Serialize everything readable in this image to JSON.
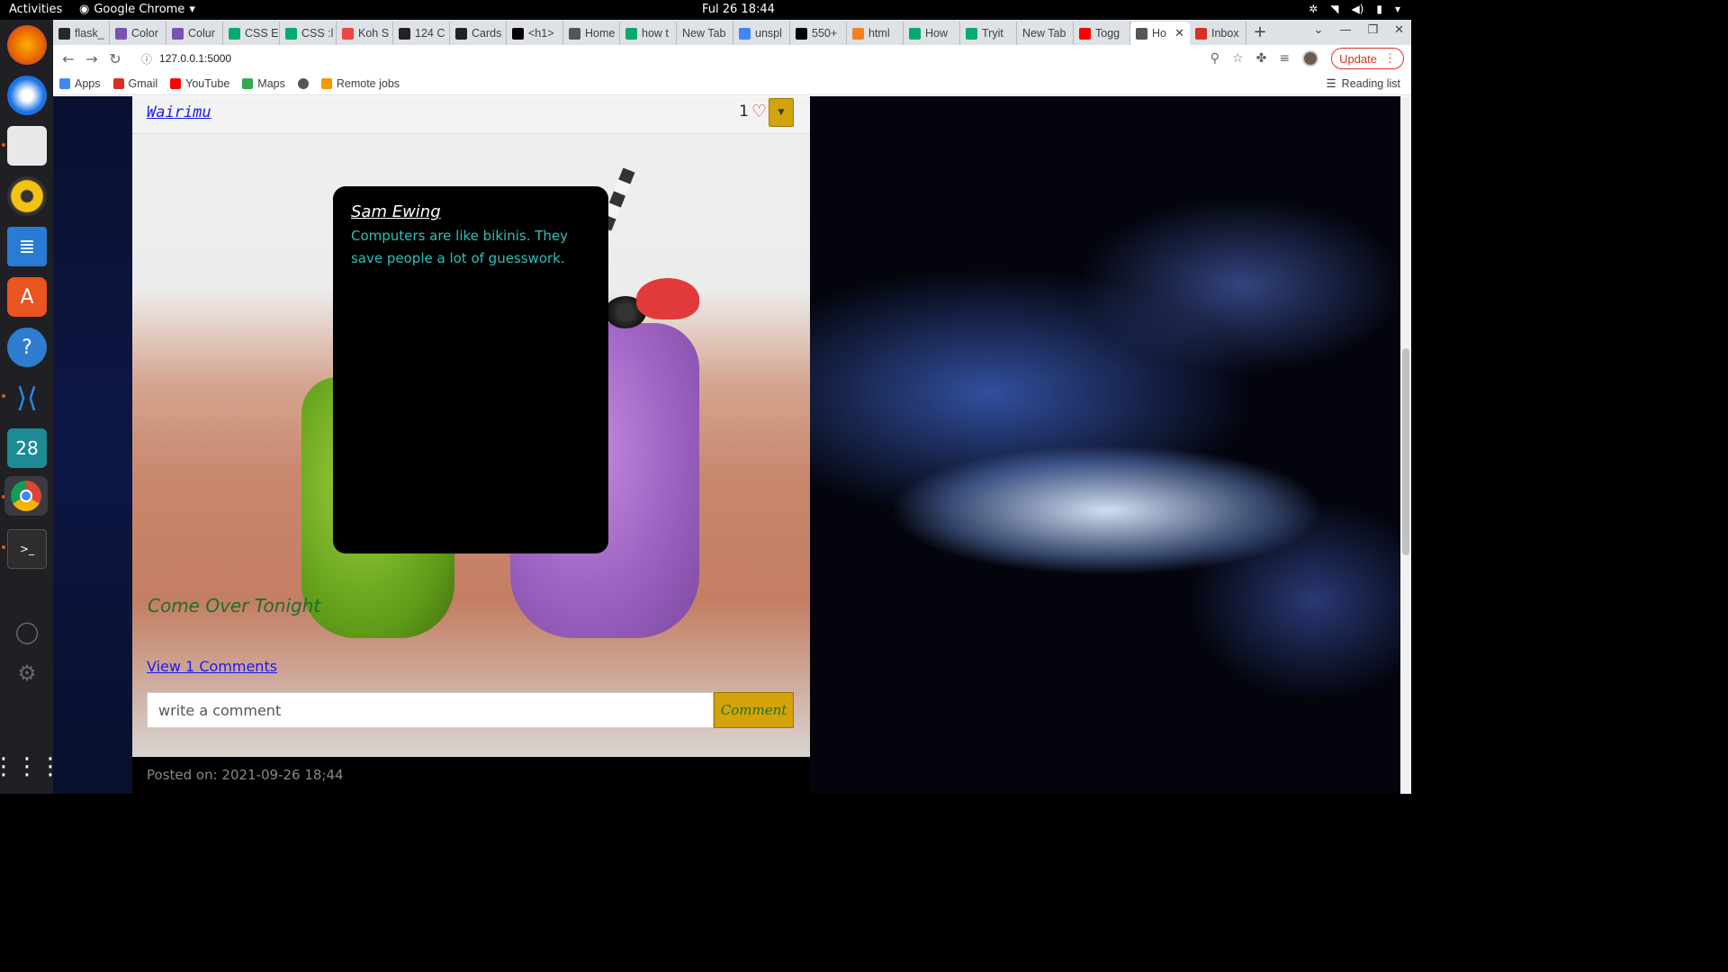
{
  "topbar": {
    "activities": "Activities",
    "app_name": "Google Chrome",
    "clock": "Ful 26  18:44"
  },
  "dock": {
    "items": [
      "firefox",
      "thunderbird",
      "files",
      "rhythmbox",
      "libreoffice-writer",
      "software",
      "help",
      "vscode",
      "calendar",
      "chrome",
      "terminal"
    ],
    "calendar_label": "28"
  },
  "tabs": [
    {
      "title": "flask_",
      "color": "#24292e"
    },
    {
      "title": "Color",
      "color": "#7952b3"
    },
    {
      "title": "Colur",
      "color": "#7952b3"
    },
    {
      "title": "CSS E",
      "color": "#04aa6d"
    },
    {
      "title": "CSS :l",
      "color": "#04aa6d"
    },
    {
      "title": "Koh S",
      "color": "#e44"
    },
    {
      "title": "124 C",
      "color": "#222"
    },
    {
      "title": "Cards",
      "color": "#222"
    },
    {
      "title": "<h1>",
      "color": "#000"
    },
    {
      "title": "Home",
      "color": "#555"
    },
    {
      "title": "how t",
      "color": "#04aa6d"
    },
    {
      "title": "New Tab",
      "color": ""
    },
    {
      "title": "unspl",
      "color": "#4285f4"
    },
    {
      "title": "550+",
      "color": "#000"
    },
    {
      "title": "html",
      "color": "#f48024"
    },
    {
      "title": "How",
      "color": "#04aa6d"
    },
    {
      "title": "Tryit",
      "color": "#04aa6d"
    },
    {
      "title": "New Tab",
      "color": ""
    },
    {
      "title": "Togg",
      "color": "#ff0000"
    },
    {
      "title": "Ho",
      "color": "#555",
      "active": true
    },
    {
      "title": "Inbox",
      "color": "#d93025"
    }
  ],
  "toolbar": {
    "url": "127.0.0.1:5000",
    "update_label": "Update"
  },
  "bookmarks": {
    "items": [
      {
        "label": "Apps",
        "color": "#4285f4"
      },
      {
        "label": "Gmail",
        "color": "#d93025"
      },
      {
        "label": "YouTube",
        "color": "#ff0000"
      },
      {
        "label": "Maps",
        "color": "#34a853"
      },
      {
        "label": "",
        "color": "#555"
      },
      {
        "label": "Remote jobs",
        "color": "#f29900"
      }
    ],
    "reading_list": "Reading list"
  },
  "post": {
    "author": "Wairimu",
    "likes": "1",
    "title": "Come Over Tonight",
    "view_comments": "View 1 Comments",
    "comment_placeholder": "write a comment",
    "comment_button": "Comment",
    "posted_on": "Posted on: 2021-09-26 18;44"
  },
  "quote": {
    "author": "Sam Ewing",
    "text": "Computers are like bikinis. They save people a lot of guesswork."
  },
  "colors": {
    "accent": "#d4a20b",
    "link": "#1a1aee",
    "quote_text": "#2ec0b8",
    "title_green": "#1f6e2a"
  }
}
